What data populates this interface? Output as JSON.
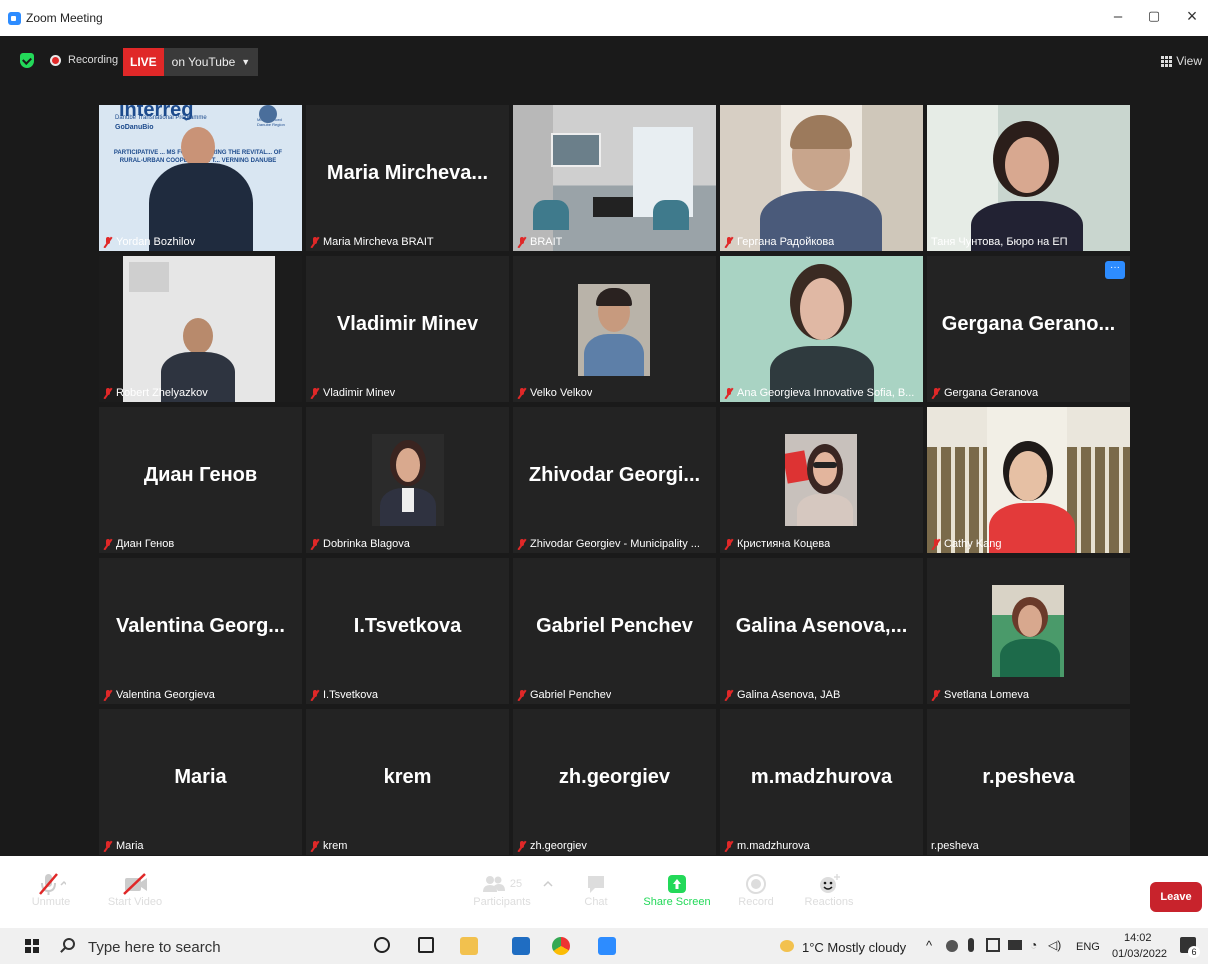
{
  "window": {
    "title": "Zoom Meeting",
    "controls": {
      "minimize": "–",
      "maximize": "▢",
      "close": "×"
    }
  },
  "topbar": {
    "recording_label": "Recording",
    "live_badge": "LIVE",
    "live_destination": "on YouTube",
    "view_label": "View"
  },
  "tiles": [
    {
      "name": "Yordan Bozhilov",
      "display": "",
      "muted": true,
      "video": true
    },
    {
      "name": "Maria Mircheva BRAIT",
      "display": "Maria  Mircheva...",
      "muted": true,
      "video": false
    },
    {
      "name": "BRAIT",
      "display": "",
      "muted": true,
      "video": true
    },
    {
      "name": "Гергана Радойкова",
      "display": "",
      "muted": true,
      "video": true
    },
    {
      "name": "Таня Чунтова, Бюро на ЕП",
      "display": "",
      "muted": false,
      "video": true,
      "active": true
    },
    {
      "name": "Robert Zhelyazkov",
      "display": "",
      "muted": true,
      "video": true
    },
    {
      "name": "Vladimir Minev",
      "display": "Vladimir Minev",
      "muted": true,
      "video": false
    },
    {
      "name": "Velko Velkov",
      "display": "",
      "muted": true,
      "video": true
    },
    {
      "name": "Ana Georgieva Innovative Sofia, B...",
      "display": "",
      "muted": true,
      "video": true
    },
    {
      "name": "Gergana Geranova",
      "display": "Gergana  Gerano...",
      "muted": true,
      "video": false
    },
    {
      "name": "Диан Генов",
      "display": "Диан Генов",
      "muted": true,
      "video": false
    },
    {
      "name": "Dobrinka Blagova",
      "display": "",
      "muted": true,
      "video": true
    },
    {
      "name": "Zhivodar Georgiev - Municipality ...",
      "display": "Zhivodar  Georgi...",
      "muted": true,
      "video": false
    },
    {
      "name": "Кристияна Коцева",
      "display": "",
      "muted": true,
      "video": true
    },
    {
      "name": "Cathy Kang",
      "display": "",
      "muted": true,
      "video": true
    },
    {
      "name": "Valentina Georgieva",
      "display": "Valentina  Georg...",
      "muted": true,
      "video": false
    },
    {
      "name": "I.Tsvetkova",
      "display": "I.Tsvetkova",
      "muted": true,
      "video": false
    },
    {
      "name": "Gabriel Penchev",
      "display": "Gabriel Penchev",
      "muted": true,
      "video": false
    },
    {
      "name": "Galina Asenova, JAB",
      "display": "Galina  Asenova,...",
      "muted": true,
      "video": false
    },
    {
      "name": "Svetlana Lomeva",
      "display": "",
      "muted": true,
      "video": true
    },
    {
      "name": "Maria",
      "display": "Maria",
      "muted": true,
      "video": false
    },
    {
      "name": "krem",
      "display": "krem",
      "muted": true,
      "video": false
    },
    {
      "name": "zh.georgiev",
      "display": "zh.georgiev",
      "muted": true,
      "video": false
    },
    {
      "name": "m.madzhurova",
      "display": "m.madzhurova",
      "muted": true,
      "video": false
    },
    {
      "name": "r.pesheva",
      "display": "r.pesheva",
      "muted": false,
      "video": false
    }
  ],
  "slide": {
    "logo": "interreg",
    "program": "Danube Transnational Programme",
    "project": "GoDanuBio",
    "region": "Multi-financed Danube Region",
    "text": "PARTICIPATIVE ... MS FOR FOSTERING THE REVITAL... OF RURAL-URBAN COOPERATION T... VERNING DANUBE"
  },
  "toolbar": {
    "unmute": "Unmute",
    "start_video": "Start Video",
    "participants": "Participants",
    "participants_count": "25",
    "chat": "Chat",
    "share_screen": "Share Screen",
    "record": "Record",
    "reactions": "Reactions",
    "leave": "Leave"
  },
  "taskbar": {
    "search_placeholder": "Type here to search",
    "weather": "1°C  Mostly cloudy",
    "language": "ENG",
    "time": "14:02",
    "date": "01/03/2022",
    "notifications": "6"
  },
  "colors": {
    "meeting_bg": "#1a1a1a",
    "tile_bg": "#232323",
    "live_red": "#e02828",
    "share_green": "#23d959",
    "leave_red": "#c8232c",
    "active_speaker": "#b6e24a",
    "zoom_blue": "#2d8cff"
  }
}
